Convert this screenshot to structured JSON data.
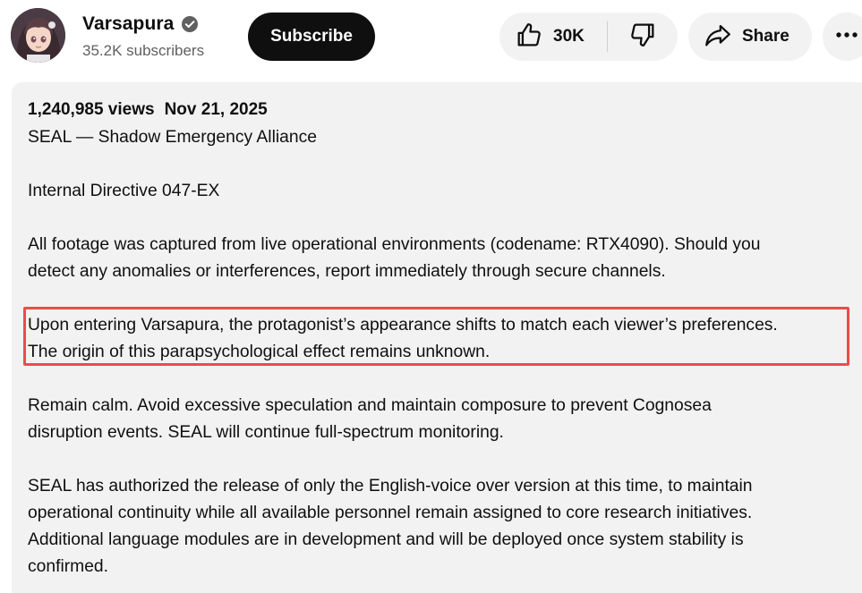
{
  "channel": {
    "name": "Varsapura",
    "subscribers": "35.2K subscribers",
    "avatar_icon": "anime-girl-avatar",
    "verified_icon": "verified-check-icon"
  },
  "actions": {
    "subscribe_label": "Subscribe",
    "like_count": "30K",
    "share_label": "Share"
  },
  "description": {
    "views": "1,240,985 views",
    "date": "Nov 21, 2025",
    "paragraphs": {
      "p1": {
        "l1": "SEAL — Shadow Emergency Alliance"
      },
      "p2": {
        "l1": "Internal Directive 047-EX"
      },
      "p3": {
        "l1": "All footage was captured from live operational environments (codename: RTX4090). Should you",
        "l2": "detect any anomalies or interferences, report immediately through secure channels."
      },
      "p4": {
        "l1": "Upon entering Varsapura, the protagonist’s appearance shifts to match each viewer’s preferences.",
        "l2": "The origin of this parapsychological effect remains unknown."
      },
      "p5": {
        "l1": "Remain calm. Avoid excessive speculation and maintain composure to prevent Cognosea",
        "l2": "disruption events. SEAL will continue full-spectrum monitoring."
      },
      "p6": {
        "l1": "SEAL has authorized the release of only the English-voice over version at this time, to maintain",
        "l2": "operational continuity while all available personnel remain assigned to core research initiatives.",
        "l3": "Additional language modules are in development and will be deployed once system stability is",
        "l4": "confirmed."
      }
    },
    "highlight_color": "#f04a4a"
  },
  "colors": {
    "subscribe_bg": "#0f0f0f",
    "pill_bg": "#f2f2f2",
    "secondary_text": "#606060"
  }
}
